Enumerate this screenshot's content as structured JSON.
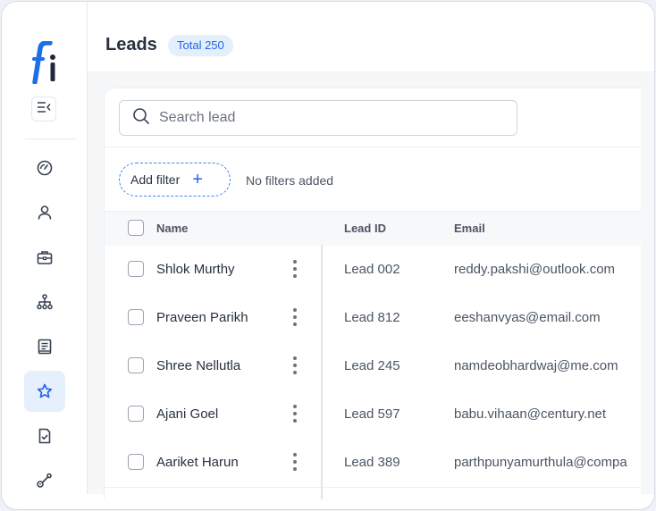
{
  "colors": {
    "accent": "#2563eb",
    "active_nav_bg": "#e6f0fc",
    "badge_bg": "#e3effd"
  },
  "sidebar": {
    "logo_icon": "brand-logo-fi",
    "collapse_icon": "collapse-menu-icon",
    "items": [
      {
        "icon": "dashboard-gauge-icon",
        "active": false
      },
      {
        "icon": "user-icon",
        "active": false
      },
      {
        "icon": "briefcase-icon",
        "active": false
      },
      {
        "icon": "org-hierarchy-icon",
        "active": false
      },
      {
        "icon": "document-list-icon",
        "active": false
      },
      {
        "icon": "star-icon",
        "active": true
      },
      {
        "icon": "file-check-icon",
        "active": false
      },
      {
        "icon": "route-icon",
        "active": false
      }
    ]
  },
  "header": {
    "title": "Leads",
    "badge": "Total 250"
  },
  "search": {
    "placeholder": "Search lead",
    "value": ""
  },
  "filters": {
    "add_label": "Add filter",
    "status": "No filters added"
  },
  "table": {
    "columns": {
      "name": "Name",
      "lead_id": "Lead ID",
      "email": "Email"
    },
    "rows": [
      {
        "name": "Shlok Murthy",
        "lead_id": "Lead 002",
        "email": "reddy.pakshi@outlook.com"
      },
      {
        "name": "Praveen Parikh",
        "lead_id": "Lead 812",
        "email": "eeshanvyas@email.com"
      },
      {
        "name": "Shree Nellutla",
        "lead_id": "Lead 245",
        "email": "namdeobhardwaj@me.com"
      },
      {
        "name": "Ajani Goel",
        "lead_id": "Lead 597",
        "email": "babu.vihaan@century.net"
      },
      {
        "name": "Aariket Harun",
        "lead_id": "Lead 389",
        "email": "parthpunyamurthula@compa"
      }
    ]
  }
}
